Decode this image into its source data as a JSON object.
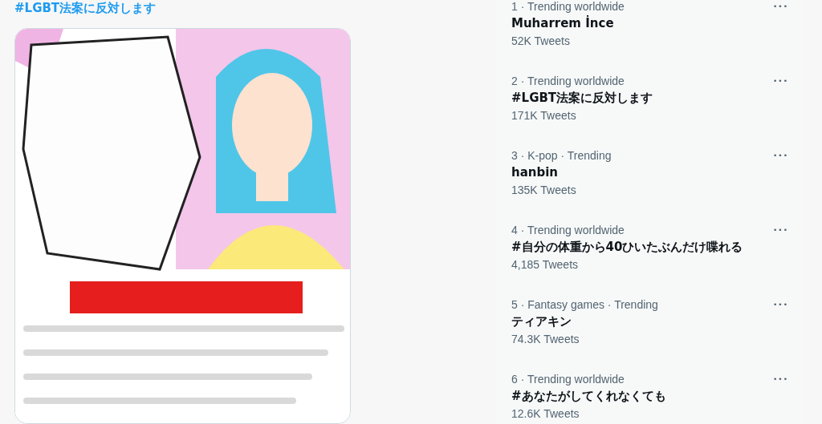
{
  "tweet": {
    "hashtag": "#LGBT法案に反対します"
  },
  "trends": [
    {
      "meta": "1 · Trending worldwide",
      "title": "Muharrem İnce",
      "count": "52K Tweets",
      "more": "•••"
    },
    {
      "meta": "2 · Trending worldwide",
      "title": "#LGBT法案に反対します",
      "count": "171K Tweets",
      "more": "•••"
    },
    {
      "meta": "3 · K-pop · Trending",
      "title": "hanbin",
      "count": "135K Tweets",
      "more": "•••"
    },
    {
      "meta": "4 · Trending worldwide",
      "title": "#自分の体重から40ひいたぶんだけ喋れる",
      "count": "4,185 Tweets",
      "more": "•••"
    },
    {
      "meta": "5 · Fantasy games · Trending",
      "title": "ティアキン",
      "count": "74.3K Tweets",
      "more": "•••"
    },
    {
      "meta": "6 · Trending worldwide",
      "title": "#あなたがしてくれなくても",
      "count": "12.6K Tweets",
      "more": "•••"
    }
  ]
}
